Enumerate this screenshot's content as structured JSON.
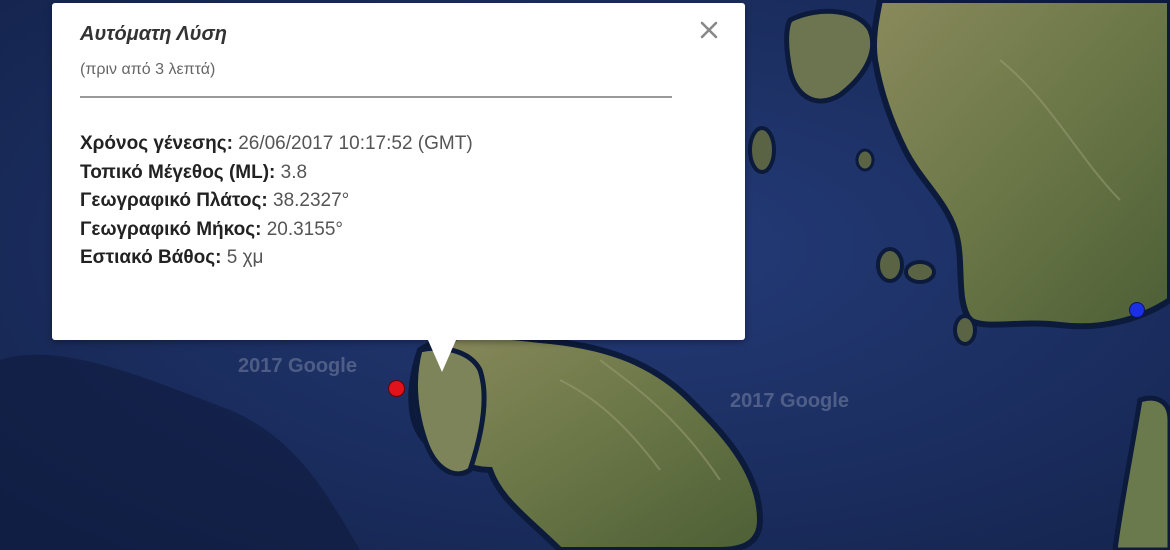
{
  "popup": {
    "title": "Αυτόματη Λύση",
    "subtitle": "(πριν από 3 λεπτά)",
    "close_icon": "close-icon",
    "rows": [
      {
        "label": "Χρόνος γένεσης:",
        "value": "26/06/2017  10:17:52 (GMT)"
      },
      {
        "label": "Τοπικό Μέγεθος (ML):",
        "value": "3.8"
      },
      {
        "label": "Γεωγραφικό Πλάτος:",
        "value": "38.2327°"
      },
      {
        "label": "Γεωγραφικό Μήκος:",
        "value": "20.3155°"
      },
      {
        "label": "Εστιακό Βάθος:",
        "value": "5 χμ"
      }
    ]
  },
  "map": {
    "watermark": "2017 Google",
    "colors": {
      "sea": "#1c2f63",
      "land": "#6f7a4e",
      "earthquake_marker": "#e0121b",
      "second_marker": "#1a2fe6"
    }
  }
}
